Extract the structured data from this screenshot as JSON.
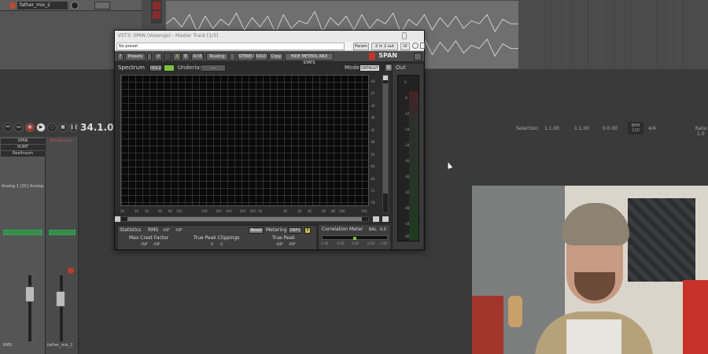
{
  "daw": {
    "track_name": "father_mix_2",
    "transport_time": "34.1.00 /",
    "selection_label": "Selection:",
    "selection_start": "1.1.00",
    "selection_end": "1.1.00",
    "selection_length": "0.0.00",
    "bpm_label": "BPM",
    "bpm_value": "120",
    "time_sig": "4/4",
    "rate_label": "Rate:",
    "rate_value": "1.0"
  },
  "mixer": {
    "fx_slots": [
      "SPAN",
      "VUMT",
      "Realtraum",
      "Elastiknum"
    ],
    "device_label": "Analog 1 [SC] Analog",
    "master_label": "RMS",
    "track_label": "father_mix_2"
  },
  "plugin": {
    "window_title": "VST3: SPAN (Voxengo) - Master Track [1/3]",
    "preset": "No preset",
    "param_btn": "Param",
    "io_btn": "2 in 2 out",
    "ui_btn": "UI",
    "toolbar": {
      "help": "?",
      "presets": "Presets",
      "a": "A",
      "b": "B",
      "ab": "A>B",
      "routing": "Routing",
      "stereo": "STEREO",
      "solo": "SOLO",
      "copy": "Copy",
      "hide_meters": "HIDE METERS AND STATS"
    },
    "brand": "SPAN",
    "spectrum_label": "Spectrum",
    "hold_btn": "HOLD",
    "underlay_label": "Underlay",
    "underlay_value": "---",
    "mode_label": "Mode",
    "mode_value": "DEFAULT",
    "db_scale": [
      "-18",
      "-24",
      "-30",
      "-36",
      "-42",
      "-48",
      "-54",
      "-60",
      "-66",
      "-72",
      "-78"
    ],
    "freq_scale": [
      "20",
      "30",
      "40",
      "60",
      "80",
      "100",
      "200",
      "300",
      "400",
      "600",
      "800",
      "1K",
      "2K",
      "3K",
      "4K",
      "6K",
      "8K",
      "10K",
      "20K"
    ],
    "out_label": "Out",
    "out_scale": [
      "0",
      "-6",
      "-12",
      "-18",
      "-24",
      "-30",
      "-36",
      "-42",
      "-48",
      "-54",
      "-60"
    ],
    "stats": {
      "title": "Statistics",
      "rms_label": "RMS",
      "rms_l": "-INF",
      "rms_r": "-INF",
      "reset": "Reset",
      "metering_label": "Metering",
      "metering_value": "DBFS",
      "yellow_btn": "P",
      "crest_label": "Max Crest Factor",
      "crest_l": "-INF",
      "crest_r": "-INF",
      "tp_clip_label": "True Peak Clippings",
      "tp_clip_l": "0",
      "tp_clip_r": "0",
      "tp_label": "True Peak",
      "tp_l": "-INF",
      "tp_r": "-INF"
    },
    "correlation": {
      "title": "Correlation Meter",
      "bal_label": "BAL",
      "bal_value": "0.0",
      "ticks": [
        "-1.00",
        "-0.50",
        "0.00",
        "0.50",
        "1.00"
      ],
      "value": 0.0
    }
  }
}
